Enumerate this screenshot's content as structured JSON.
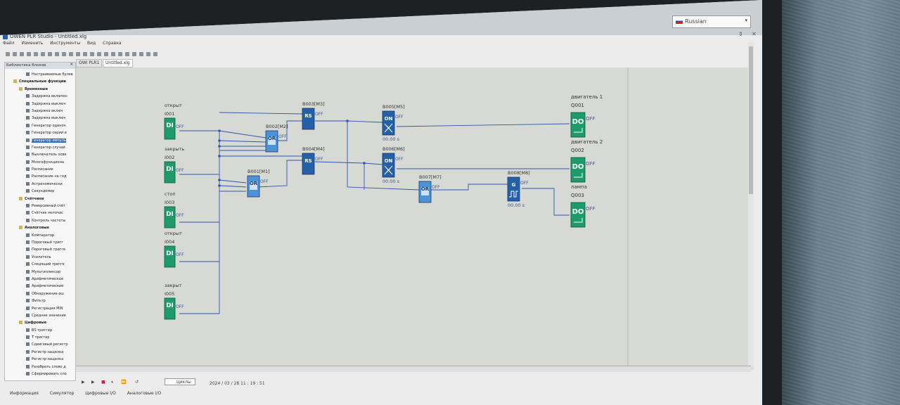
{
  "app": {
    "title": "OWEN PLR Studio - Untitled.xlg",
    "language": "Russian",
    "colors": {
      "di_block": "#1f9a6b",
      "logic_block": "#2b79c2",
      "wire": "#2e56b0",
      "canvas": "#d7d9d4"
    }
  },
  "menu": [
    "Файл",
    "Изменить",
    "Инструменты",
    "Вид",
    "Справка"
  ],
  "tabs": [
    "OWI PLR1",
    "Untitled.xlg"
  ],
  "library": {
    "title": "Библиотека блоков",
    "items": [
      {
        "label": "Настраиваемые булев",
        "type": "item"
      },
      {
        "label": "Специальные функции",
        "type": "folder"
      },
      {
        "label": "Временные",
        "type": "folder"
      },
      {
        "label": "Задержка включен",
        "type": "item"
      },
      {
        "label": "Задержка выключ",
        "type": "item"
      },
      {
        "label": "Задержка включ",
        "type": "item"
      },
      {
        "label": "Задержка выключ",
        "type": "item"
      },
      {
        "label": "Генератор одиноч",
        "type": "item"
      },
      {
        "label": "Генератор серии и",
        "type": "item"
      },
      {
        "label": "Генератор импуль",
        "type": "item",
        "selected": true
      },
      {
        "label": "Генератор случай",
        "type": "item"
      },
      {
        "label": "Выключатель осве",
        "type": "item"
      },
      {
        "label": "Многофункциона",
        "type": "item"
      },
      {
        "label": "Расписание",
        "type": "item"
      },
      {
        "label": "Расписание на год",
        "type": "item"
      },
      {
        "label": "Астрономически",
        "type": "item"
      },
      {
        "label": "Секундомер",
        "type": "item"
      },
      {
        "label": "Счётчики",
        "type": "folder"
      },
      {
        "label": "Реверсивный счёт",
        "type": "item"
      },
      {
        "label": "Счётчик моточас",
        "type": "item"
      },
      {
        "label": "Контроль частоты",
        "type": "item"
      },
      {
        "label": "Аналоговые",
        "type": "folder"
      },
      {
        "label": "Компаратор",
        "type": "item"
      },
      {
        "label": "Пороговый тригг",
        "type": "item"
      },
      {
        "label": "Пороговый тригге",
        "type": "item"
      },
      {
        "label": "Усилитель",
        "type": "item"
      },
      {
        "label": "Следящий тригге",
        "type": "item"
      },
      {
        "label": "Мультиплексор",
        "type": "item"
      },
      {
        "label": "Арифметическое",
        "type": "item"
      },
      {
        "label": "Арифметические",
        "type": "item"
      },
      {
        "label": "Обнаружение ош",
        "type": "item"
      },
      {
        "label": "Фильтр",
        "type": "item"
      },
      {
        "label": "Регистрация MIN",
        "type": "item"
      },
      {
        "label": "Среднее значение",
        "type": "item"
      },
      {
        "label": "Цифровые",
        "type": "folder"
      },
      {
        "label": "RS триггер",
        "type": "item"
      },
      {
        "label": "Т триггер",
        "type": "item"
      },
      {
        "label": "Сдвиговый регистр",
        "type": "item"
      },
      {
        "label": "Регистр защелка",
        "type": "item"
      },
      {
        "label": "Регистр защелка",
        "type": "item"
      },
      {
        "label": "Разобрать слово д",
        "type": "item"
      },
      {
        "label": "Сформировать сло",
        "type": "item"
      }
    ]
  },
  "inputs": [
    {
      "name": "открыт",
      "id": "I001",
      "type": "DI",
      "state": "OFF"
    },
    {
      "name": "закрыть",
      "id": "I002",
      "type": "DI",
      "state": "OFF"
    },
    {
      "name": "стоп",
      "id": "I003",
      "type": "DI",
      "state": "OFF"
    },
    {
      "name": "открыт",
      "id": "I004",
      "type": "DI",
      "state": "OFF"
    },
    {
      "name": "закрыт",
      "id": "I005",
      "type": "DI",
      "state": "OFF"
    }
  ],
  "blocks": [
    {
      "id": "B001[M1]",
      "type": "OR",
      "state": "OFF"
    },
    {
      "id": "B002[M2]",
      "type": "OR",
      "state": "OFF"
    },
    {
      "id": "B003[M3]",
      "type": "RS",
      "state": "OFF"
    },
    {
      "id": "B004[M4]",
      "type": "RS",
      "state": "OFF"
    },
    {
      "id": "B005[M5]",
      "type": "ON",
      "state": "OFF",
      "time": "00.00 s"
    },
    {
      "id": "B006[M6]",
      "type": "ON",
      "state": "OFF",
      "time": "00.00 s"
    },
    {
      "id": "B007[M7]",
      "type": "OR",
      "state": "OFF"
    },
    {
      "id": "B008[M8]",
      "type": "G",
      "state": "OFF",
      "time": "00.00 s"
    }
  ],
  "outputs": [
    {
      "name": "двигатель 1",
      "id": "Q001",
      "type": "DO",
      "state": "OFF"
    },
    {
      "name": "двигатель 2",
      "id": "Q002",
      "type": "DO",
      "state": "OFF"
    },
    {
      "name": "лампа",
      "id": "Q003",
      "type": "DO",
      "state": "OFF"
    }
  ],
  "status": {
    "cycles_label": "Циклы",
    "timestamp": "2024 / 03 / 28  11 : 19 : 51"
  },
  "bottom_tabs": [
    "Информация",
    "Симулятор",
    "Цифровые I/O",
    "Аналоговые I/O"
  ]
}
